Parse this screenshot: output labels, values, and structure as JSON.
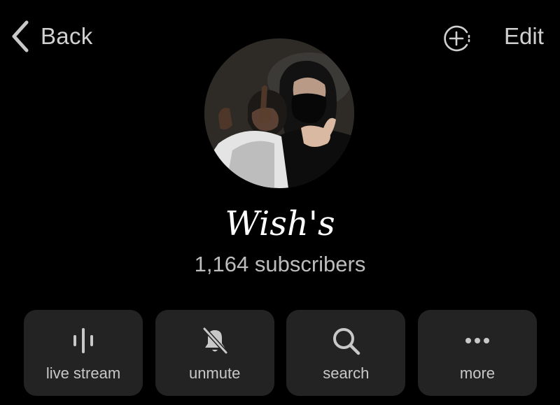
{
  "header": {
    "back_label": "Back",
    "edit_label": "Edit",
    "add_icon": "circle-plus-icon"
  },
  "profile": {
    "avatar_alt": "channel-avatar",
    "name": "Wish's",
    "subscribers": "1,164 subscribers"
  },
  "actions": [
    {
      "label": "live stream",
      "icon": "live-stream-icon"
    },
    {
      "label": "unmute",
      "icon": "bell-slash-icon"
    },
    {
      "label": "search",
      "icon": "search-icon"
    },
    {
      "label": "more",
      "icon": "more-dots-icon"
    }
  ],
  "colors": {
    "background": "#000000",
    "button_bg": "#232323",
    "primary_text": "#ffffff",
    "secondary_text": "#bdbdbd"
  }
}
